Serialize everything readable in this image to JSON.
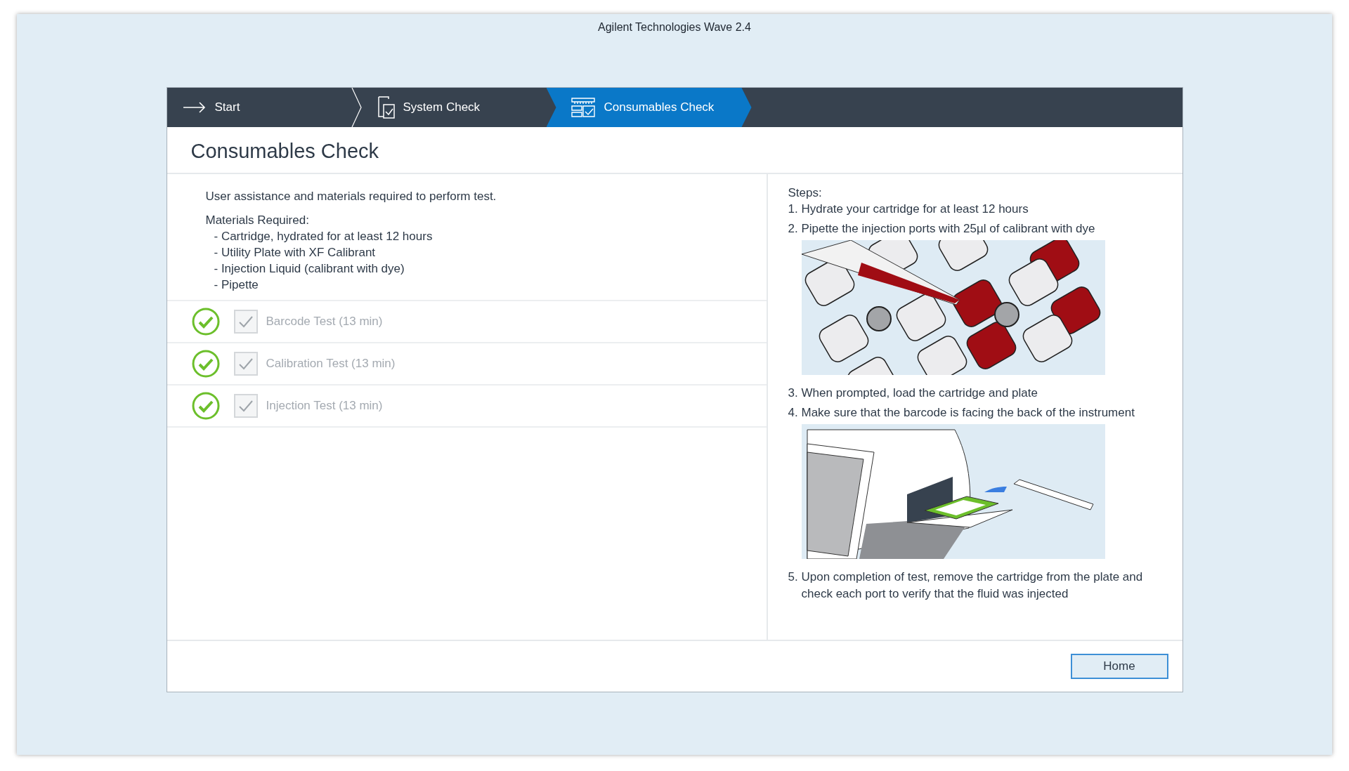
{
  "window": {
    "title": "Agilent Technologies Wave 2.4"
  },
  "breadcrumb": [
    {
      "label": "Start",
      "selected": false
    },
    {
      "label": "System Check",
      "selected": false
    },
    {
      "label": "Consumables Check",
      "selected": true
    }
  ],
  "heading": "Consumables Check",
  "intro": "User assistance and materials required to perform test.",
  "materials": {
    "title": "Materials Required:",
    "items": [
      "- Cartridge, hydrated for at least 12 hours",
      "- Utility Plate with XF Calibrant",
      "- Injection Liquid (calibrant with dye)",
      "- Pipette"
    ]
  },
  "tests": [
    {
      "label": "Barcode Test (13 min)",
      "passed": true,
      "checked": true,
      "disabled": true
    },
    {
      "label": "Calibration Test (13 min)",
      "passed": true,
      "checked": true,
      "disabled": true
    },
    {
      "label": "Injection Test (13 min)",
      "passed": true,
      "checked": true,
      "disabled": true
    }
  ],
  "steps": {
    "title": "Steps:",
    "items": [
      {
        "kind": "step",
        "number": "1.",
        "text": "Hydrate your cartridge for at least 12 hours"
      },
      {
        "kind": "step",
        "number": "2.",
        "text": "Pipette the injection ports with 25µl of calibrant with dye"
      },
      {
        "kind": "picture"
      },
      {
        "kind": "step",
        "number": "3.",
        "text": "When prompted, load the cartridge and plate"
      },
      {
        "kind": "step",
        "number": "4.",
        "text": "Make sure that the barcode is facing the back of the instrument"
      },
      {
        "kind": "picture"
      },
      {
        "kind": "step",
        "number": "5.",
        "text": "Upon completion of test, remove the cartridge from the plate and check each port to verify that the fluid was injected"
      }
    ]
  },
  "buttons": [
    {
      "label": "Home"
    }
  ]
}
